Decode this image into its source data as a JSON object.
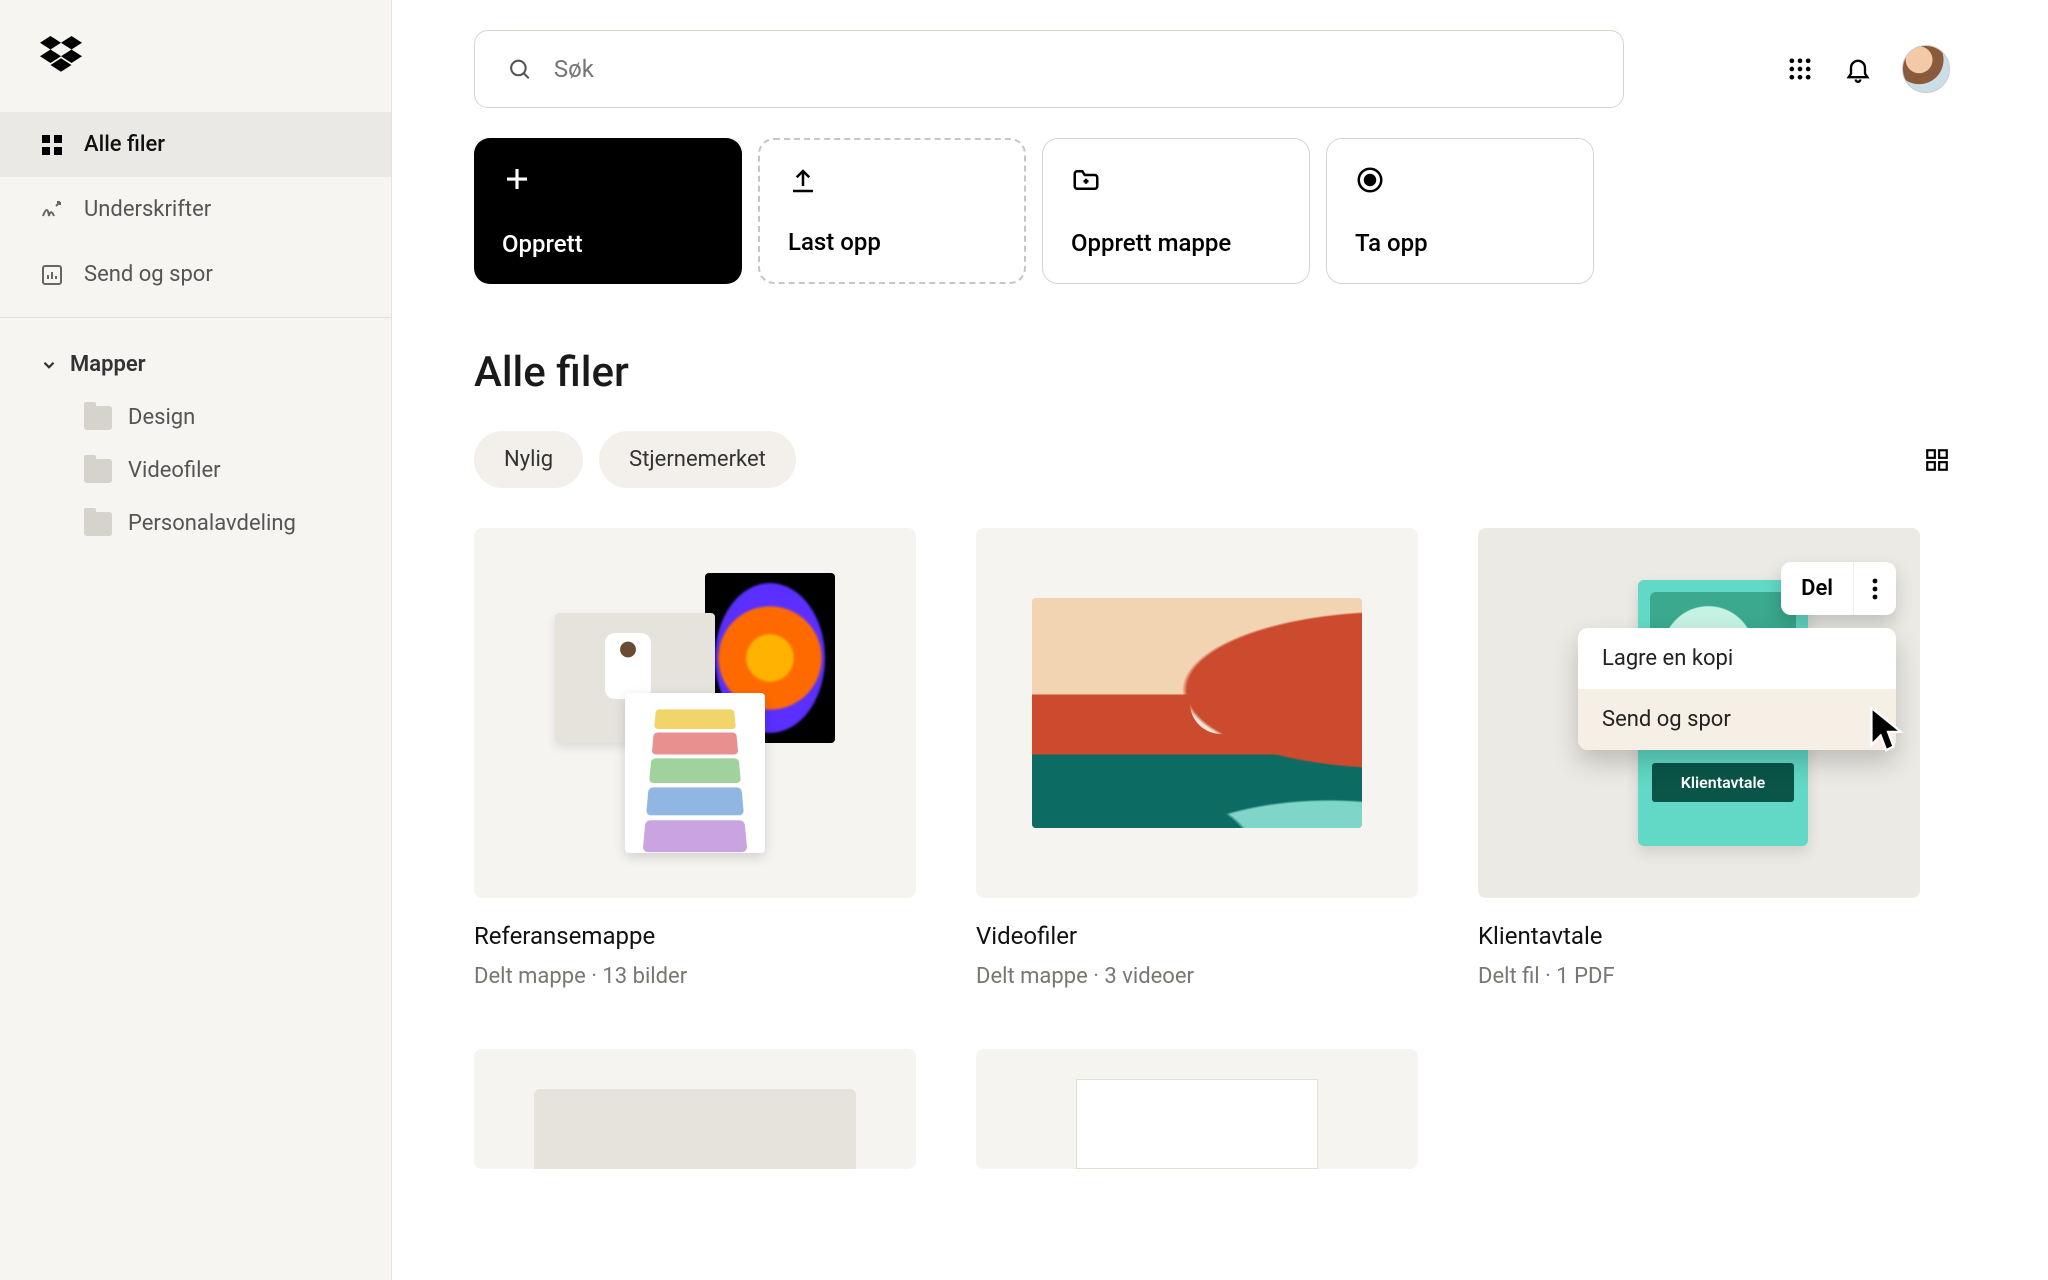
{
  "search": {
    "placeholder": "Søk"
  },
  "sidebar": {
    "nav": [
      {
        "label": "Alle filer"
      },
      {
        "label": "Underskrifter"
      },
      {
        "label": "Send og spor"
      }
    ],
    "folders_header": "Mapper",
    "folders": [
      {
        "label": "Design"
      },
      {
        "label": "Videofiler"
      },
      {
        "label": "Personalavdeling"
      }
    ]
  },
  "actions": {
    "create": "Opprett",
    "upload": "Last opp",
    "create_folder": "Opprett mappe",
    "record": "Ta opp"
  },
  "page_title": "Alle filer",
  "filters": {
    "recent": "Nylig",
    "starred": "Stjernemerket"
  },
  "cards": [
    {
      "title": "Referansemappe",
      "meta": "Delt mappe · 13 bilder"
    },
    {
      "title": "Videofiler",
      "meta": "Delt mappe · 3 videoer"
    },
    {
      "title": "Klientavtale",
      "meta": "Delt fil · 1 PDF"
    }
  ],
  "card3": {
    "doc_label": "Klientavtale",
    "share_label": "Del",
    "menu": {
      "copy": "Lagre en kopi",
      "send": "Send og spor"
    }
  }
}
